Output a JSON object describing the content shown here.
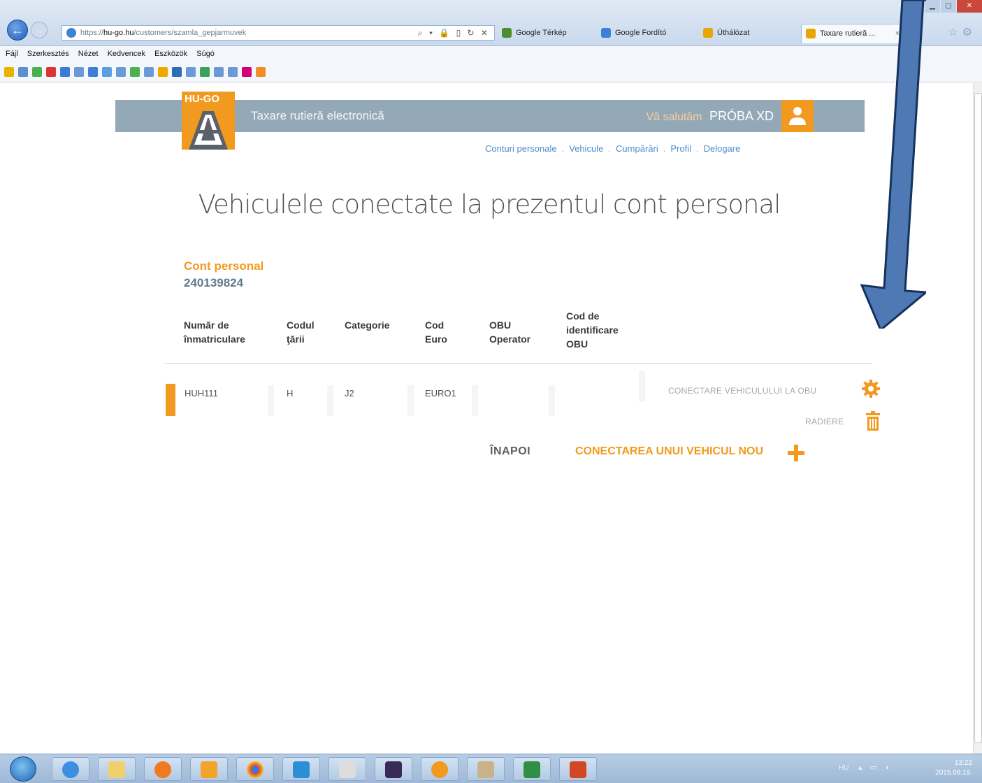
{
  "browser": {
    "address": {
      "prefix": "https://",
      "host": "hu-go.hu",
      "path": "/customers/szamla_gepjarmuvek",
      "tools": "⌕ ▾ 🔒 ▯ ↻ ✕"
    },
    "tabs": [
      {
        "label": "Google Térkép",
        "color": "#4a8e32"
      },
      {
        "label": "Google Fordító",
        "color": "#3f7fd6"
      },
      {
        "label": "Úthálózat",
        "color": "#e6a700"
      },
      {
        "label": "Taxare rutieră ...",
        "color": "#e6a700",
        "close": "×"
      }
    ],
    "menu": [
      "Fájl",
      "Szerkesztés",
      "Nézet",
      "Kedvencek",
      "Eszközök",
      "Súgó"
    ]
  },
  "site": {
    "logo_text": "HU-GO",
    "title": "Taxare rutieră electronică",
    "greeting": "Vă salutăm",
    "username": "PRÓBA XD",
    "nav": [
      "Conturi personale",
      "Vehicule",
      "Cumpărări",
      "Profil",
      "Delogare"
    ],
    "nav_sep": "."
  },
  "main": {
    "page_title": "Vehiculele conectate la prezentul cont personal",
    "account_label": "Cont personal",
    "account_number": "240139824",
    "columns": [
      [
        "Număr de",
        "înmatriculare"
      ],
      [
        "Codul",
        "ţării"
      ],
      [
        "Categorie"
      ],
      [
        "Cod",
        "Euro"
      ],
      [
        "OBU",
        "Operator"
      ],
      [
        "Cod de",
        "identificare",
        "OBU"
      ]
    ],
    "rows": [
      {
        "plate": "HUH111",
        "country": "H",
        "category": "J2",
        "euro": "EURO1",
        "obu_operator": "",
        "obu_id": "",
        "action_connect": "CONECTARE VEHICULULUI LA OBU",
        "action_delete": "RADIERE"
      }
    ],
    "back": "ÎNAPOI",
    "add_new": "CONECTAREA UNUI VEHICUL NOU"
  },
  "colors": {
    "accent": "#f29a1f",
    "header": "#93a9b8",
    "arrow": "#4f79b4"
  },
  "taskbar": {
    "lang": "HU",
    "time": "13:22",
    "date": "2015.09.19."
  }
}
